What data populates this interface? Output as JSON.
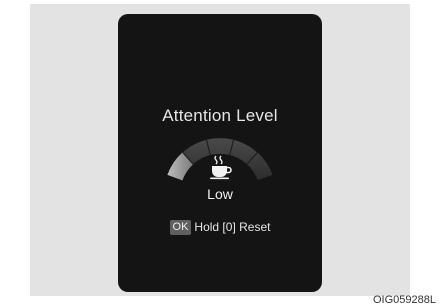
{
  "screen": {
    "title": "Attention Level",
    "level": {
      "label": "Low",
      "fraction": 0.2
    },
    "icon": "coffee-cup-icon",
    "hint": {
      "key_label": "OK",
      "action_text": "Hold [0] Reset"
    }
  },
  "caption": "OIG059288L",
  "colors": {
    "screen_bg": "#141414",
    "panel_bg": "#e3e3e3",
    "gauge_active": "#9a9a9a",
    "gauge_track": "#3a3a3a",
    "text": "#e6e6e6"
  }
}
